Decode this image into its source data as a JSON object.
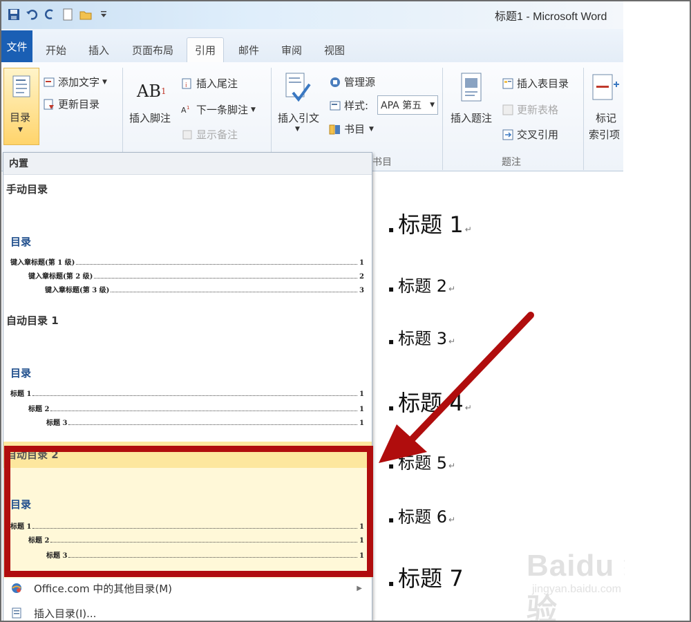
{
  "window": {
    "title": "标题1 - Microsoft Word"
  },
  "tabs": {
    "file": "文件",
    "items": [
      "开始",
      "插入",
      "页面布局",
      "引用",
      "邮件",
      "审阅",
      "视图"
    ],
    "active": "引用"
  },
  "ribbon": {
    "toc": {
      "big_button": "目录",
      "add_text": "添加文字",
      "update_toc": "更新目录"
    },
    "footnotes": {
      "insert_footnote": "插入脚注",
      "insert_endnote": "插入尾注",
      "next_footnote": "下一条脚注",
      "show_notes": "显示备注",
      "ab_glyph": "AB",
      "superscript": "1"
    },
    "citations": {
      "insert_citation": "插入引文",
      "manage_sources": "管理源",
      "style_label": "样式:",
      "style_value": "APA 第五",
      "bibliography": "书目",
      "group_label_fragment": "书目"
    },
    "captions": {
      "insert_caption": "插入题注",
      "insert_table_of_figures": "插入表目录",
      "update_table": "更新表格",
      "cross_reference": "交叉引用",
      "group_label": "题注"
    },
    "index": {
      "mark_entry_line1": "标记",
      "mark_entry_line2": "索引项"
    }
  },
  "dropdown": {
    "header": "内置",
    "manual": {
      "name": "手动目录",
      "toc_title": "目录",
      "rows": [
        {
          "label": "键入章标题(第 1 级)",
          "page": "1"
        },
        {
          "label": "键入章标题(第 2 级)",
          "page": "2"
        },
        {
          "label": "键入章标题(第 3 级)",
          "page": "3"
        }
      ]
    },
    "auto1": {
      "name": "自动目录 1",
      "toc_title": "目录",
      "rows": [
        {
          "label": "标题 1",
          "page": "1"
        },
        {
          "label": "标题 2",
          "page": "1"
        },
        {
          "label": "标题 3",
          "page": "1"
        }
      ]
    },
    "auto2": {
      "name": "自动目录 2",
      "toc_title": "目录",
      "rows": [
        {
          "label": "标题 1",
          "page": "1"
        },
        {
          "label": "标题 2",
          "page": "1"
        },
        {
          "label": "标题 3",
          "page": "1"
        }
      ]
    },
    "menu": [
      {
        "label": "Office.com 中的其他目录(M)"
      },
      {
        "label": "插入目录(I)..."
      }
    ]
  },
  "document": {
    "headings": [
      "标题 1",
      "标题 2",
      "标题 3",
      "标题 4",
      "标题 5",
      "标题 6",
      "标题 7"
    ]
  },
  "watermark": {
    "logo": "Baidu 经验",
    "url": "jingyan.baidu.com"
  },
  "colors": {
    "highlight_red": "#b00d0d",
    "accent_blue": "#1a5fb4",
    "selected_yellow": "#fde79e"
  }
}
